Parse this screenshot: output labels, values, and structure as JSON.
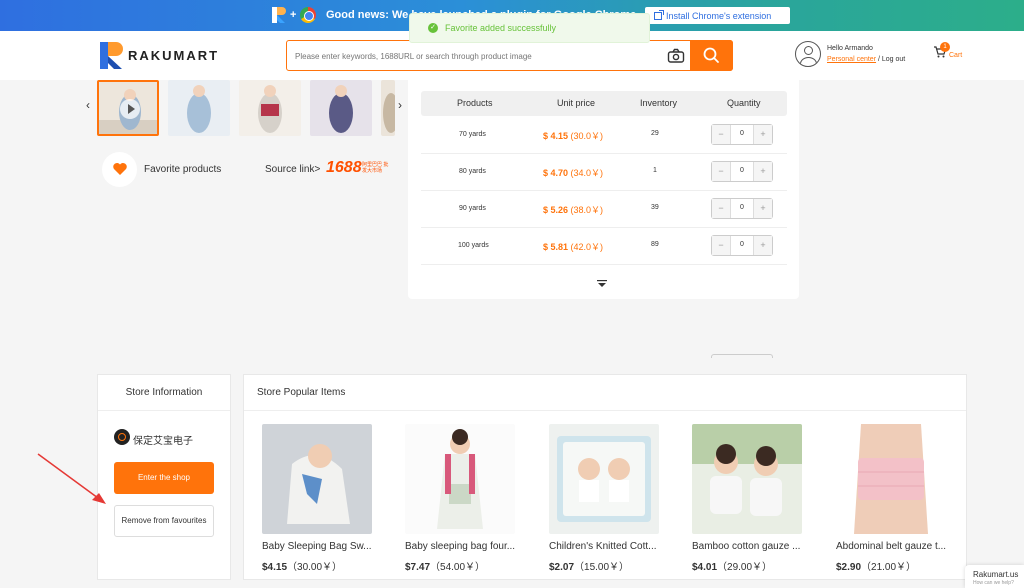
{
  "banner": {
    "news": "Good news: We have launched a plugin for Google Chrome",
    "extension_button": "Install Chrome's extension"
  },
  "toast": {
    "message": "Favorite added successfully"
  },
  "header": {
    "logo_text": "RAKUMART",
    "search_placeholder": "Please enter keywords, 1688URL or search through product image",
    "greeting": "Hello Armando",
    "personal_center": "Personal center",
    "separator": " / ",
    "logout": "Log out",
    "cart_label": "Cart",
    "cart_count": "1"
  },
  "product": {
    "favorite_label": "Favorite products",
    "source_label": "Source link>",
    "source_brand": "1688",
    "source_brand_sub": "阿里巴巴 批发大市场"
  },
  "sku_table": {
    "headers": [
      "Products",
      "Unit price",
      "Inventory",
      "Quantity"
    ],
    "rows": [
      {
        "product": "70 yards",
        "price": "$ 4.15",
        "cny": "(30.0￥)",
        "inventory": "29",
        "qty": "0"
      },
      {
        "product": "80 yards",
        "price": "$ 4.70",
        "cny": "(34.0￥)",
        "inventory": "1",
        "qty": "0"
      },
      {
        "product": "90 yards",
        "price": "$ 5.26",
        "cny": "(38.0￥)",
        "inventory": "39",
        "qty": "0"
      },
      {
        "product": "100 yards",
        "price": "$ 5.81",
        "cny": "(42.0￥)",
        "inventory": "89",
        "qty": "0"
      }
    ]
  },
  "store": {
    "title": "Store Information",
    "name": "保定艾宝电子",
    "enter_button": "Enter the shop",
    "remove_button": "Remove from favourites"
  },
  "popular": {
    "title": "Store Popular Items",
    "items": [
      {
        "name": "Baby Sleeping Bag Sw...",
        "price": "$4.15",
        "cny": "（30.00￥）"
      },
      {
        "name": "Baby sleeping bag four...",
        "price": "$7.47",
        "cny": "（54.00￥）"
      },
      {
        "name": "Children's Knitted Cott...",
        "price": "$2.07",
        "cny": "（15.00￥）"
      },
      {
        "name": "Bamboo cotton gauze ...",
        "price": "$4.01",
        "cny": "（29.00￥）"
      },
      {
        "name": "Abdominal belt gauze t...",
        "price": "$2.90",
        "cny": "（21.00￥）"
      }
    ]
  },
  "chat": {
    "title": "Rakumart.us",
    "subtitle": "How can we help?"
  },
  "colors": {
    "accent": "#ff730b",
    "success": "#67c23a",
    "brand_blue": "#2f6fe0"
  }
}
